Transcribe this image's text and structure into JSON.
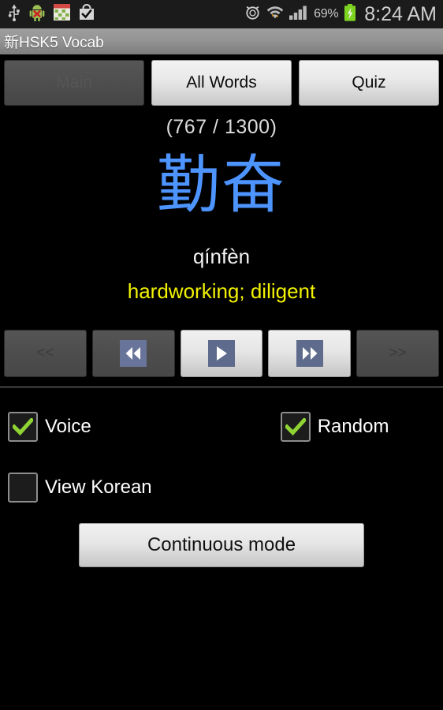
{
  "statusbar": {
    "left_icons": [
      {
        "name": "usb-icon",
        "label": "USB"
      },
      {
        "name": "android-debug-icon",
        "label": "Android debug"
      },
      {
        "name": "calendar-icon",
        "label": "Calendar"
      },
      {
        "name": "play-store-bag-icon",
        "label": "Store download complete"
      }
    ],
    "right_icons": [
      {
        "name": "alarm-clock-icon",
        "label": "Alarm set"
      },
      {
        "name": "wifi-data-transfer-icon",
        "label": "Wi-Fi"
      },
      {
        "name": "cellular-signal-icon",
        "label": "Signal"
      }
    ],
    "battery_percent": "69%",
    "battery_state": "charging",
    "clock": "8:24 AM"
  },
  "titlebar": {
    "title": "新HSK5 Vocab"
  },
  "tabs": [
    {
      "label": "Main",
      "state": "selected"
    },
    {
      "label": "All Words",
      "state": "normal"
    },
    {
      "label": "Quiz",
      "state": "normal"
    }
  ],
  "word": {
    "counter": "(767 / 1300)",
    "hanzi": "勤奋",
    "pinyin": "qínfèn",
    "meaning": "hardworking; diligent"
  },
  "controls": [
    {
      "name": "prev-page-button",
      "label": "<<",
      "style": "dark",
      "icon": null
    },
    {
      "name": "previous-button",
      "label": "",
      "style": "dark",
      "icon": "rewind-icon"
    },
    {
      "name": "play-button",
      "label": "",
      "style": "light",
      "icon": "play-icon"
    },
    {
      "name": "next-button",
      "label": "",
      "style": "light",
      "icon": "fast-forward-icon"
    },
    {
      "name": "next-page-button",
      "label": ">>",
      "style": "dark",
      "icon": null
    }
  ],
  "options": [
    {
      "name": "voice",
      "label": "Voice",
      "checked": true
    },
    {
      "name": "random",
      "label": "Random",
      "checked": true
    },
    {
      "name": "view-korean",
      "label": "View Korean",
      "checked": false
    }
  ],
  "continuous": {
    "label": "Continuous mode"
  },
  "colors": {
    "hanzi": "#4d94ff",
    "meaning": "#f2f200",
    "check": "#8fd434",
    "media_glyph_bg": "#5f6b8c",
    "battery": "#7ed321"
  }
}
